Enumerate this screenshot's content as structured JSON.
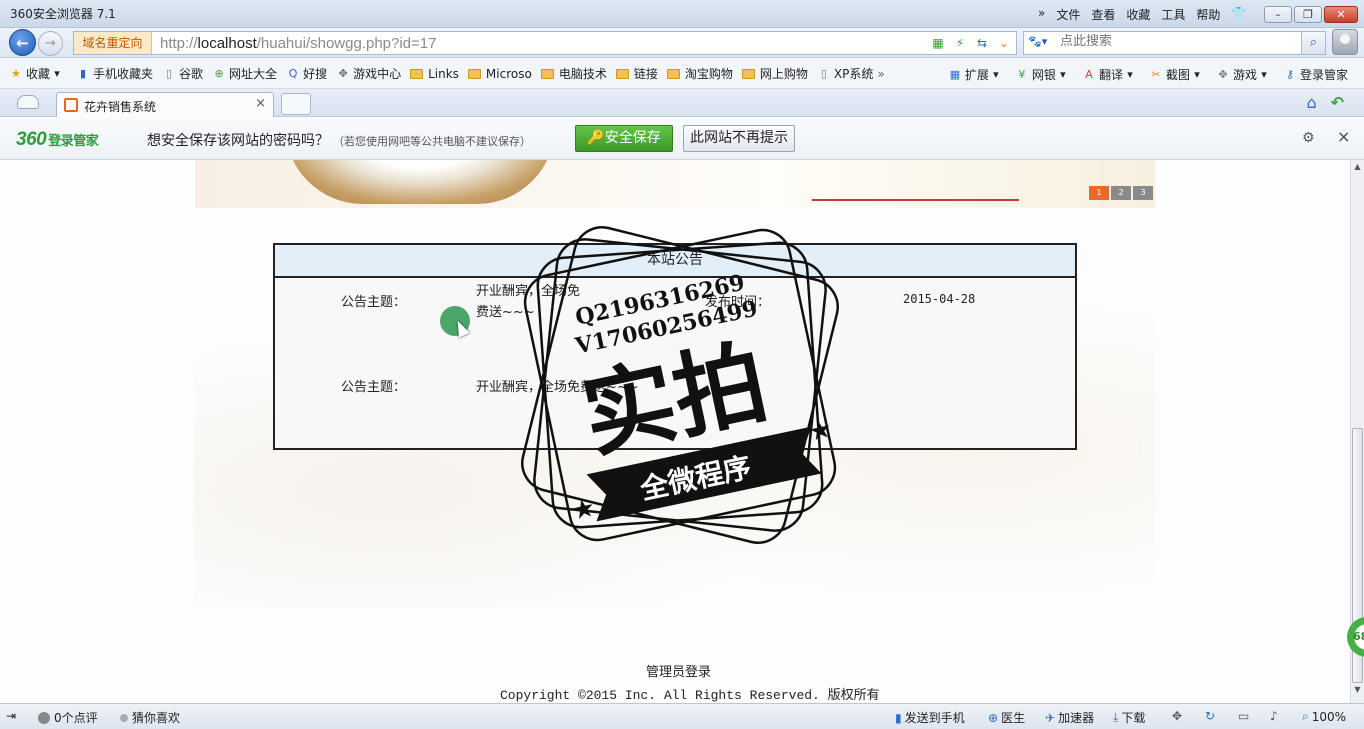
{
  "browser": {
    "title": "360安全浏览器 7.1",
    "menu": [
      "文件",
      "查看",
      "收藏",
      "工具",
      "帮助"
    ],
    "redirect_tag": "域名重定向",
    "url_prefix": "http://",
    "url_host": "localhost",
    "url_path": "/huahui/showgg.php?id=17",
    "search_placeholder": "点此搜索"
  },
  "bookmarks": {
    "items": [
      "收藏",
      "手机收藏夹",
      "谷歌",
      "网址大全",
      "好搜",
      "游戏中心",
      "Links",
      "Microso",
      "电脑技术",
      "链接",
      "淘宝购物",
      "网上购物",
      "XP系统"
    ],
    "right": [
      "扩展",
      "网银",
      "翻译",
      "截图",
      "游戏",
      "登录管家"
    ],
    "overflow": "»"
  },
  "tab": {
    "title": "花卉销售系统",
    "close": "×"
  },
  "password_bar": {
    "logo_num": "360",
    "logo_text": "登录管家",
    "message": "想安全保存该网站的密码吗？",
    "hint": "（若您使用网吧等公共电脑不建议保存）",
    "save_label": "安全保存",
    "never_label": "此网站不再提示",
    "close": "×"
  },
  "page": {
    "slides": [
      "1",
      "2",
      "3"
    ],
    "notice": {
      "heading": "本站公告",
      "row1_label": "公告主题：",
      "row1_subject": "开业酬宾，全场免费送~~~",
      "row1_time_label": "发布时间：",
      "row1_time": "2015-04-28",
      "row2_label": "公告主题：",
      "row2_content": "开业酬宾，全场免费送~~~"
    },
    "admin_login": "管理员登录",
    "copyright": "Copyright ©2015 Inc. All Rights Reserved. 版权所有"
  },
  "watermark": {
    "line1": "Q2196316269",
    "line2": "V17060256499",
    "big": "实拍",
    "banner": "全微程序"
  },
  "badge": "68",
  "statusbar": {
    "reviews": "0个点评",
    "guess": "猜你喜欢",
    "send_phone": "发送到手机",
    "doctor": "医生",
    "accelerator": "加速器",
    "download": "下载",
    "zoom": "100%"
  }
}
